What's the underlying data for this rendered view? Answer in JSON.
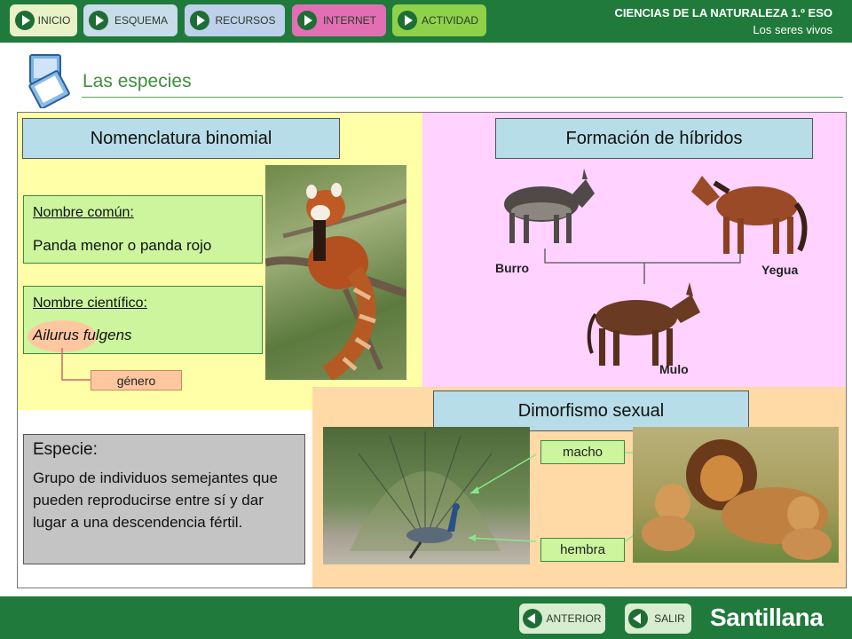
{
  "header": {
    "nav": [
      {
        "label": "INICIO",
        "bg": "#e9f2c7"
      },
      {
        "label": "ESQUEMA",
        "bg": "#c9dcea"
      },
      {
        "label": "RECURSOS",
        "bg": "#bed0ea"
      },
      {
        "label": "INTERNET",
        "bg": "#e26fb4"
      },
      {
        "label": "ACTIVIDAD",
        "bg": "#8fd24a"
      }
    ],
    "course": "CIENCIAS DE LA NATURALEZA 1.º ESO",
    "topic": "Los seres vivos"
  },
  "page": {
    "title": "Las especies"
  },
  "binomial": {
    "header": "Nomenclatura binomial",
    "common_label": "Nombre común:",
    "common_value": "Panda menor o panda rojo",
    "sci_label": "Nombre científico:",
    "genus": "Ailurus",
    "species": "fulgens",
    "genus_tag": "género"
  },
  "hybrids": {
    "header": "Formación de híbridos",
    "parent1": "Burro",
    "parent2": "Yegua",
    "offspring": "Mulo"
  },
  "species_def": {
    "title": "Especie:",
    "text": "Grupo de individuos semejantes que pueden reproducirse entre sí y dar lugar a una descendencia fértil."
  },
  "dimorphism": {
    "header": "Dimorfismo sexual",
    "male": "macho",
    "female": "hembra"
  },
  "footer": {
    "prev": "ANTERIOR",
    "exit": "SALIR",
    "brand": "Santillana"
  },
  "colors": {
    "bar_green": "#1f7a3c",
    "binomial_bg": "#ffffa8",
    "hybrids_bg": "#ffd2ff",
    "dimorphism_bg": "#ffd9a6",
    "header_box": "#b7dde8",
    "green_box": "#ccf59e",
    "definition_box": "#c4c4c4",
    "genus_tag": "#ffc7a0"
  }
}
